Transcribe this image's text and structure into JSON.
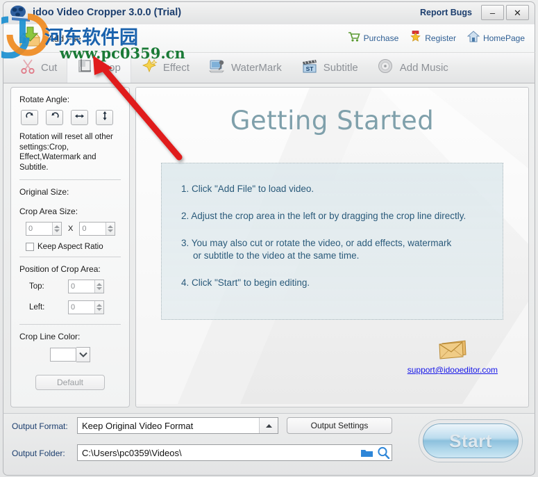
{
  "window": {
    "title": "idoo Video Cropper 3.0.0 (Trial)",
    "report_bugs": "Report Bugs",
    "minimize": "–",
    "close": "✕",
    "logo_icon": "film-reel-icon"
  },
  "toolbar": {
    "add_file": "Add File",
    "add_file_icon": "add-file-download-icon",
    "links": [
      {
        "label": "Purchase",
        "icon": "shopping-cart-icon"
      },
      {
        "label": "Register",
        "icon": "star-badge-icon"
      },
      {
        "label": "HomePage",
        "icon": "home-icon"
      }
    ]
  },
  "tabs": [
    {
      "label": "Cut",
      "icon": "scissors-icon",
      "active": false
    },
    {
      "label": "Crop",
      "icon": "crop-icon",
      "active": true
    },
    {
      "label": "Effect",
      "icon": "sparkle-star-icon",
      "active": false
    },
    {
      "label": "WaterMark",
      "icon": "watermark-screen-icon",
      "active": false
    },
    {
      "label": "Subtitle",
      "icon": "clapperboard-st-icon",
      "active": false
    },
    {
      "label": "Add Music",
      "icon": "music-disc-icon",
      "active": false
    }
  ],
  "left_panel": {
    "rotate_angle_label": "Rotate Angle:",
    "rotate_buttons": [
      {
        "name": "rotate-clockwise-button",
        "icon": "rotate-cw-icon"
      },
      {
        "name": "rotate-counterclockwise-button",
        "icon": "rotate-ccw-icon"
      },
      {
        "name": "flip-horizontal-button",
        "icon": "flip-horizontal-icon"
      },
      {
        "name": "flip-vertical-button",
        "icon": "flip-vertical-icon"
      }
    ],
    "rotation_note": "Rotation will reset all other settings:Crop, Effect,Watermark and Subtitle.",
    "original_size_label": "Original Size:",
    "crop_area_size_label": "Crop Area Size:",
    "crop_width_value": "0",
    "crop_height_value": "0",
    "size_separator": "X",
    "keep_aspect_ratio_label": "Keep Aspect Ratio",
    "keep_aspect_ratio_checked": false,
    "position_label": "Position of Crop Area:",
    "top_label": "Top:",
    "top_value": "0",
    "left_label": "Left:",
    "left_value": "0",
    "crop_line_color_label": "Crop Line Color:",
    "crop_line_color_value": "#ffffff",
    "default_button": "Default"
  },
  "getting_started": {
    "title": "Getting Started",
    "steps": [
      {
        "text": "1. Click \"Add File\" to load video.",
        "continuation": ""
      },
      {
        "text": "2. Adjust the crop area in the left or by dragging the crop line directly.",
        "continuation": ""
      },
      {
        "text": "3. You may also cut or rotate the video, or add effects, watermark",
        "continuation": "or subtitle to the video at the same time."
      },
      {
        "text": "4. Click \"Start\" to begin editing.",
        "continuation": ""
      }
    ],
    "support_email": "support@idooeditor.com",
    "mail_icon": "envelope-icon"
  },
  "bottom": {
    "output_format_label": "Output Format:",
    "output_format_value": "Keep Original Video Format",
    "output_settings_button": "Output Settings",
    "output_folder_label": "Output Folder:",
    "output_folder_value": "C:\\Users\\pc0359\\Videos\\",
    "browse_folder_icon": "folder-open-icon",
    "search_folder_icon": "magnifier-icon",
    "start_button": "Start"
  },
  "watermark": {
    "site_name": "河东软件园",
    "site_url": "www.pc0359.cn",
    "logo_icon": "watermark-logo-icon"
  },
  "colors": {
    "title_text": "#1b3d6d",
    "link_blue": "#2f5f94",
    "gs_title": "#7fa0ab",
    "gs_step": "#2a5a7a",
    "email_link": "#1515e8",
    "accent_start": "#8cc0dd",
    "watermark_blue": "#1b63ae",
    "watermark_green": "#1a7a36",
    "arrow_red": "#e01b1b"
  }
}
